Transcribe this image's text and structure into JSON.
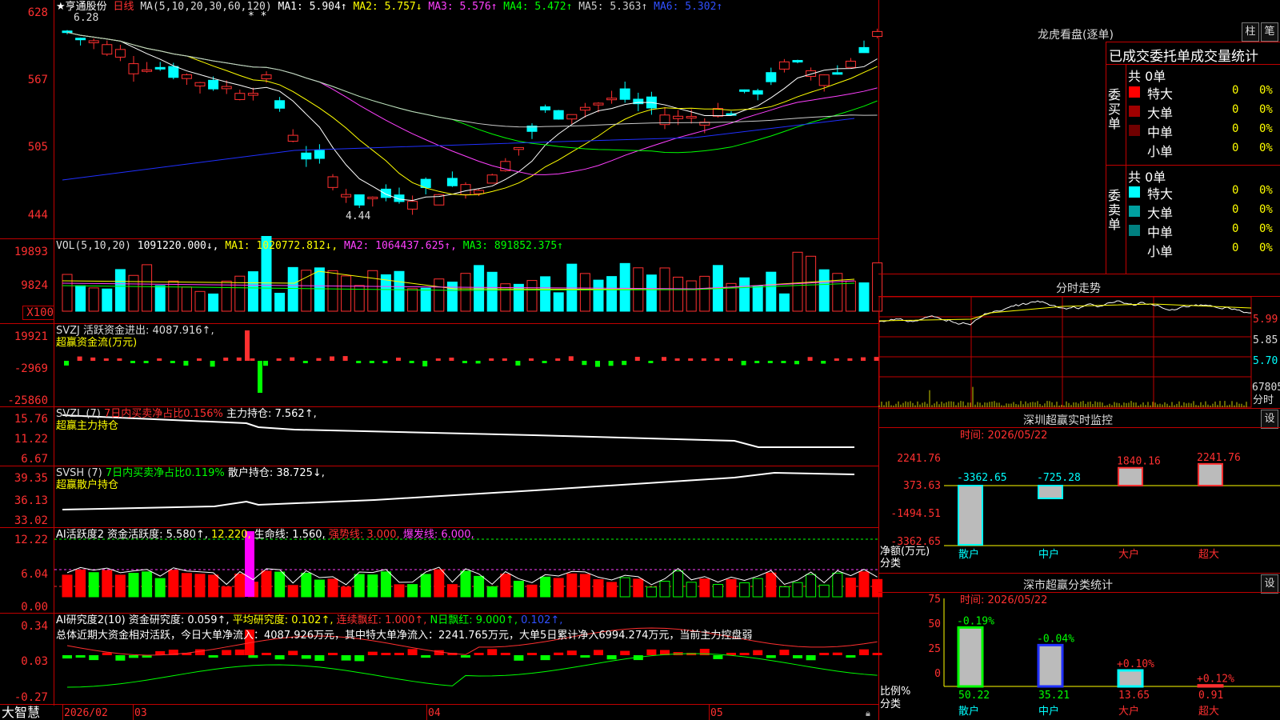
{
  "app": {
    "brand": "大智慧",
    "stock_name": "★亨通股份",
    "period": "日线"
  },
  "main_chart": {
    "ma_header": "MA(5,10,20,30,60,120)",
    "ma1": "MA1: 5.904↑",
    "ma2": "MA2: 5.757↓",
    "ma3": "MA3: 5.576↑",
    "ma4": "MA4: 5.472↑",
    "ma5": "MA5: 5.363↑",
    "ma6": "MA6: 5.302↑",
    "high_marker": "6.28",
    "low_marker": "4.44",
    "y_labels": [
      "628",
      "567",
      "505",
      "444"
    ],
    "stars": "* *"
  },
  "vol_panel": {
    "header": "VOL(5,10,20)",
    "value": "1091220.000↓,",
    "ma1": "MA1: 1020772.812↓,",
    "ma2": "MA2: 1064437.625↑,",
    "ma3": "MA3: 891852.375↑",
    "y_labels": [
      "19893",
      "9824",
      "X100"
    ]
  },
  "svzj_panel": {
    "header": "SVZJ  活跃资金进出: 4087.916↑,",
    "sub": "超赢资金流(万元)",
    "y_labels": [
      "19921",
      "-2969",
      "-25860"
    ]
  },
  "svzl_panel": {
    "header_a": "SVZL (7)",
    "header_b": "7日内买卖净占比0.156%",
    "header_c": "主力持仓: 7.562↑,",
    "sub": "超赢主力持仓",
    "y_labels": [
      "15.76",
      "11.22",
      "6.67"
    ]
  },
  "svsh_panel": {
    "header_a": "SVSH (7)",
    "header_b": "7日内买卖净占比0.119%",
    "header_c": "散户持仓: 38.725↓,",
    "sub": "超赢散户持仓",
    "y_labels": [
      "39.35",
      "36.13",
      "33.02"
    ]
  },
  "ai_active_panel": {
    "header_a": "AI活跃度2  资金活跃度: 5.580↑,",
    "header_b": "12.220,",
    "header_c": "生命线: 1.560,",
    "header_d": "强势线: 3.000,",
    "header_e": "爆发线: 6.000,",
    "y_labels": [
      "12.22",
      "6.04",
      "0.00"
    ]
  },
  "ai_research_panel": {
    "header_a": "AI研究度2(10)  资金研究度: 0.059↑,",
    "header_b": "平均研究度: 0.102↑,",
    "header_c": "连续飘红: 1.000↑,",
    "header_d": "N日飘红: 9.000↑,",
    "header_e": "0.102↑,",
    "summary": "总体近期大资金相对活跃，今日大单净流入：4087.926万元，其中特大单净流入：2241.765万元，大单5日累计净入6994.274万元，当前主力控盘弱",
    "y_labels": [
      "0.34",
      "0.03",
      "-0.27"
    ]
  },
  "time_axis": {
    "labels": [
      "2026/02",
      "03",
      "04",
      "05"
    ]
  },
  "dragon_tiger": {
    "title": "龙虎看盘(逐单)",
    "btn_a": "柱",
    "btn_b": "笔",
    "tabs": "已成交委托单成交量统计",
    "buy_label": "委买单",
    "sell_label": "委卖单",
    "buy_total": "共 0单",
    "sell_total": "共 0单",
    "buy_rows": [
      {
        "name": "特大",
        "count": "0",
        "pct": "0%",
        "color": "#ff0000"
      },
      {
        "name": "大单",
        "count": "0",
        "pct": "0%",
        "color": "#a00000"
      },
      {
        "name": "中单",
        "count": "0",
        "pct": "0%",
        "color": "#700000"
      },
      {
        "name": "小单",
        "count": "0",
        "pct": "0%",
        "color": ""
      }
    ],
    "sell_rows": [
      {
        "name": "特大",
        "count": "0",
        "pct": "0%",
        "color": "#00ffff"
      },
      {
        "name": "大单",
        "count": "0",
        "pct": "0%",
        "color": "#00a0a0"
      },
      {
        "name": "中单",
        "count": "0",
        "pct": "0%",
        "color": "#008080"
      },
      {
        "name": "小单",
        "count": "0",
        "pct": "0%",
        "color": ""
      }
    ]
  },
  "intraday": {
    "title": "分时走势",
    "y_labels": [
      "5.99",
      "5.85",
      "5.70"
    ],
    "vol_label": "67805",
    "vol_unit": "分时"
  },
  "sz_monitor": {
    "title": "深圳超赢实时监控",
    "btn": "设",
    "time": "时间: 2026/05/22",
    "y_labels": [
      "2241.76",
      "373.63",
      "-1494.51",
      "-3362.65"
    ],
    "unit": "净额(万元)",
    "cat_label": "分类",
    "categories": [
      "散户",
      "中户",
      "大户",
      "超大"
    ],
    "value_labels": [
      "-3362.65",
      "-725.28",
      "1840.16",
      "2241.76"
    ]
  },
  "sz_class": {
    "title": "深市超赢分类统计",
    "btn": "设",
    "time": "时间: 2026/05/22",
    "y_labels": [
      "75",
      "50",
      "25",
      "0"
    ],
    "unit": "比例%",
    "cat_label": "分类",
    "categories": [
      "散户",
      "中户",
      "大户",
      "超大"
    ],
    "pct_labels": [
      "-0.19%",
      "-0.04%",
      "+0.10%",
      "+0.12%"
    ],
    "values": [
      "50.22",
      "35.21",
      "13.65",
      "0.91"
    ]
  }
}
